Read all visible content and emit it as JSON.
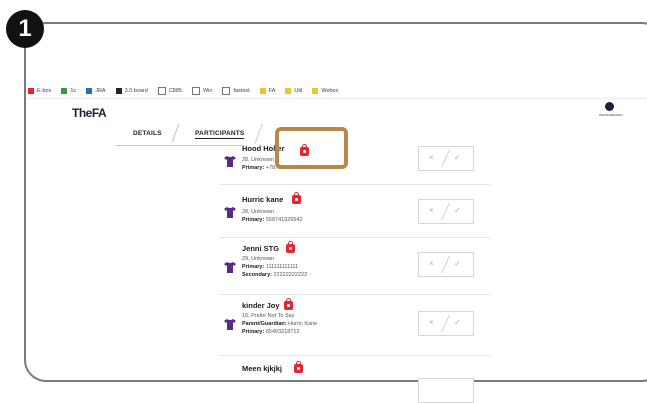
{
  "step": "1",
  "bookmarks": [
    "E-box",
    "1c",
    "JRA",
    "3.0 board",
    "C885",
    "Win",
    "fastest",
    "FA",
    "Util",
    "Webex"
  ],
  "app": {
    "logo": "TheFA",
    "user_label": "WHITEHEIRONG"
  },
  "tabs": [
    {
      "label": "DETAILS",
      "active": false
    },
    {
      "label": "PARTICIPANTS",
      "active": true
    }
  ],
  "participants": [
    {
      "name": "Hood Holler",
      "lines": [
        {
          "prefix": "",
          "text": "28, Unknown"
        },
        {
          "prefix": "Primary:",
          "text": "+7873214556674O"
        }
      ]
    },
    {
      "name": "Hurric kane",
      "lines": [
        {
          "prefix": "",
          "text": "28, Unknown"
        },
        {
          "prefix": "Primary:",
          "text": "558741326542"
        }
      ]
    },
    {
      "name": "Jenni STG",
      "lines": [
        {
          "prefix": "",
          "text": "29, Unknown"
        },
        {
          "prefix": "Primary:",
          "text": "111111111111"
        },
        {
          "prefix": "Secondary:",
          "text": "22222222222"
        }
      ]
    },
    {
      "name": "kinder Joy",
      "lines": [
        {
          "prefix": "",
          "text": "16, Prefer Not To Say"
        },
        {
          "prefix": "Parent/Guardian:",
          "text": "Hurric Kane"
        },
        {
          "prefix": "Primary:",
          "text": "65493218712"
        }
      ]
    },
    {
      "name": "Meen kjkjkj",
      "lines": []
    }
  ],
  "toggle": {
    "reject": "×",
    "accept": "✓"
  },
  "colors": {
    "shirt": "#5b2a86",
    "lock": "#e3262f",
    "highlight": "#b8874a",
    "brand": "#1b2136"
  }
}
